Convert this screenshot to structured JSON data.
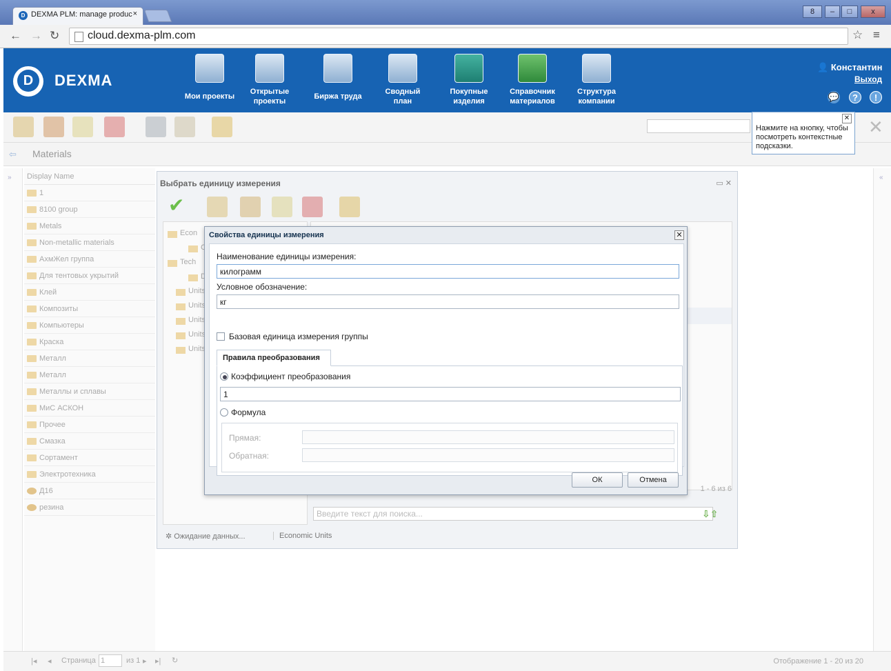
{
  "browser": {
    "tab_title": "DEXMA PLM: manage produc",
    "tab_close": "×",
    "url": "cloud.dexma-plm.com",
    "win_user": "8",
    "win_min": "–",
    "win_max": "□",
    "win_close": "x"
  },
  "header": {
    "logo": "DEXMA",
    "nav": [
      {
        "label": "Мои проекты"
      },
      {
        "label": "Открытые проекты"
      },
      {
        "label": "Биржа труда"
      },
      {
        "label": "Сводный план"
      },
      {
        "label": "Покупные изделия"
      },
      {
        "label": "Справочник материалов"
      },
      {
        "label": "Структура компании"
      }
    ],
    "user": "Константин",
    "logout": "Выход"
  },
  "tooltip": {
    "text": "Нажмите на кнопку, чтобы посмотреть контекстные подсказки."
  },
  "materials": {
    "title": "Materials",
    "column": "Display Name",
    "items": [
      "1",
      "8100 group",
      "Metals",
      "Non-metallic materials",
      "АхмЖел группа",
      "Для тентовых укрытий",
      "Клей",
      "Композиты",
      "Компьютеры",
      "Краска",
      "Металл",
      "Металл",
      "Металлы и сплавы",
      "МиС АСКОН",
      "Прочее",
      "Смазка",
      "Сортамент",
      "Электротехника",
      "Д16",
      "резина"
    ]
  },
  "pager": {
    "page_label": "Страница",
    "page_value": "1",
    "of_label": "из 1",
    "display": "Отображение 1 - 20 из 20"
  },
  "unit_window": {
    "title": "Выбрать единицу измерения",
    "tree": [
      "Econ",
      "C",
      "Tech",
      "D",
      "Units",
      "Units",
      "Units",
      "Units",
      "Units"
    ],
    "page_count": "1 - 6 из 6",
    "search_placeholder": "Введите текст для поиска...",
    "status": "Ожидание данных...",
    "status_group": "Economic Units"
  },
  "dialog": {
    "title": "Свойства единицы измерения",
    "name_label": "Наименование единицы измерения:",
    "name_value": "килограмм",
    "symbol_label": "Условное обозначение:",
    "symbol_value": "кг",
    "base_label": "Базовая единица измерения группы",
    "tab_rules": "Правила преобразования",
    "coef_label": "Коэффициент преобразования",
    "coef_value": "1",
    "formula_label": "Формула",
    "direct_label": "Прямая:",
    "inverse_label": "Обратная:",
    "ok": "ОК",
    "cancel": "Отмена"
  }
}
